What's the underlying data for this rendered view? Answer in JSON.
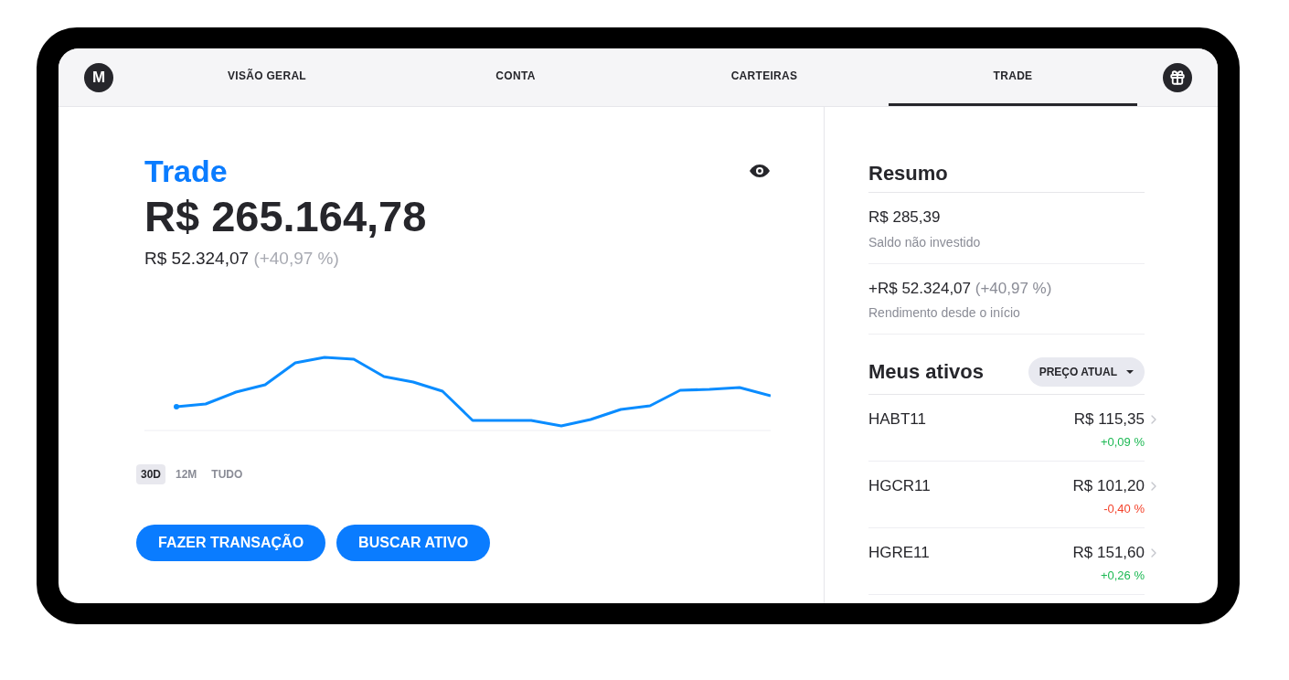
{
  "logo": {
    "letter": "M"
  },
  "tabs": [
    {
      "label": "VISÃO GERAL",
      "selected": false
    },
    {
      "label": "CONTA",
      "selected": false
    },
    {
      "label": "CARTEIRAS",
      "selected": false
    },
    {
      "label": "TRADE",
      "selected": true
    }
  ],
  "portfolio": {
    "title": "Trade",
    "total": "R$ 265.164,78",
    "gain": "R$ 52.324,07",
    "gain_percent": "(+40,97 %)"
  },
  "ranges": [
    {
      "label": "30D",
      "selected": true
    },
    {
      "label": "12M",
      "selected": false
    },
    {
      "label": "TUDO",
      "selected": false
    }
  ],
  "actions": [
    "FAZER TRANSAÇÃO",
    "BUSCAR ATIVO"
  ],
  "summary": {
    "title": "Resumo",
    "items": [
      {
        "value": "R$ 285,39",
        "label": "Saldo não investido"
      },
      {
        "value": "+R$ 52.324,07",
        "extra": "(+40,97 %)",
        "label": "Rendimento desde o início"
      }
    ]
  },
  "assets": {
    "title": "Meus ativos",
    "sort": "PREÇO ATUAL",
    "rows": [
      {
        "ticker": "HABT11",
        "price": "R$ 115,35",
        "change": "+0,09 %",
        "color": "#1db954"
      },
      {
        "ticker": "HGCR11",
        "price": "R$ 101,20",
        "change": "-0,40 %",
        "color": "#f4432c"
      },
      {
        "ticker": "HGRE11",
        "price": "R$ 151,60",
        "change": "+0,26 %",
        "color": "#1db954"
      }
    ]
  }
}
